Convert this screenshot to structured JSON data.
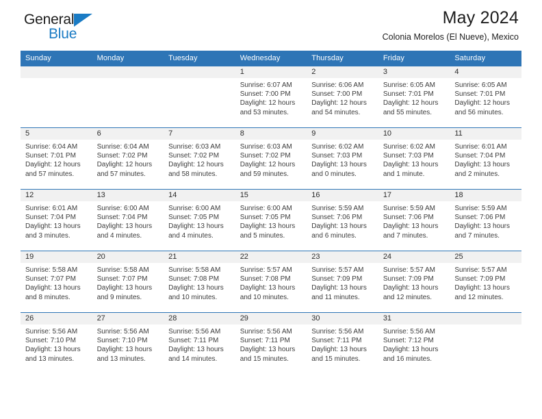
{
  "brand": {
    "line1": "General",
    "line2": "Blue",
    "accent_color": "#1a7bc4"
  },
  "header": {
    "title": "May 2024",
    "subtitle": "Colonia Morelos (El Nueve), Mexico"
  },
  "theme": {
    "header_bg": "#2e75b6",
    "daynum_band_bg": "#f1f1f1",
    "row_divider": "#2e75b6",
    "text": "#3b3b3b"
  },
  "weekday_headers": [
    "Sunday",
    "Monday",
    "Tuesday",
    "Wednesday",
    "Thursday",
    "Friday",
    "Saturday"
  ],
  "labels": {
    "sunrise_prefix": "Sunrise: ",
    "sunset_prefix": "Sunset: ",
    "daylight_prefix": "Daylight: "
  },
  "weeks": [
    [
      {
        "day": "",
        "empty": true
      },
      {
        "day": "",
        "empty": true
      },
      {
        "day": "",
        "empty": true
      },
      {
        "day": "1",
        "sunrise": "Sunrise: 6:07 AM",
        "sunset": "Sunset: 7:00 PM",
        "daylight_line1": "Daylight: 12 hours",
        "daylight_line2": "and 53 minutes."
      },
      {
        "day": "2",
        "sunrise": "Sunrise: 6:06 AM",
        "sunset": "Sunset: 7:00 PM",
        "daylight_line1": "Daylight: 12 hours",
        "daylight_line2": "and 54 minutes."
      },
      {
        "day": "3",
        "sunrise": "Sunrise: 6:05 AM",
        "sunset": "Sunset: 7:01 PM",
        "daylight_line1": "Daylight: 12 hours",
        "daylight_line2": "and 55 minutes."
      },
      {
        "day": "4",
        "sunrise": "Sunrise: 6:05 AM",
        "sunset": "Sunset: 7:01 PM",
        "daylight_line1": "Daylight: 12 hours",
        "daylight_line2": "and 56 minutes."
      }
    ],
    [
      {
        "day": "5",
        "sunrise": "Sunrise: 6:04 AM",
        "sunset": "Sunset: 7:01 PM",
        "daylight_line1": "Daylight: 12 hours",
        "daylight_line2": "and 57 minutes."
      },
      {
        "day": "6",
        "sunrise": "Sunrise: 6:04 AM",
        "sunset": "Sunset: 7:02 PM",
        "daylight_line1": "Daylight: 12 hours",
        "daylight_line2": "and 57 minutes."
      },
      {
        "day": "7",
        "sunrise": "Sunrise: 6:03 AM",
        "sunset": "Sunset: 7:02 PM",
        "daylight_line1": "Daylight: 12 hours",
        "daylight_line2": "and 58 minutes."
      },
      {
        "day": "8",
        "sunrise": "Sunrise: 6:03 AM",
        "sunset": "Sunset: 7:02 PM",
        "daylight_line1": "Daylight: 12 hours",
        "daylight_line2": "and 59 minutes."
      },
      {
        "day": "9",
        "sunrise": "Sunrise: 6:02 AM",
        "sunset": "Sunset: 7:03 PM",
        "daylight_line1": "Daylight: 13 hours",
        "daylight_line2": "and 0 minutes."
      },
      {
        "day": "10",
        "sunrise": "Sunrise: 6:02 AM",
        "sunset": "Sunset: 7:03 PM",
        "daylight_line1": "Daylight: 13 hours",
        "daylight_line2": "and 1 minute."
      },
      {
        "day": "11",
        "sunrise": "Sunrise: 6:01 AM",
        "sunset": "Sunset: 7:04 PM",
        "daylight_line1": "Daylight: 13 hours",
        "daylight_line2": "and 2 minutes."
      }
    ],
    [
      {
        "day": "12",
        "sunrise": "Sunrise: 6:01 AM",
        "sunset": "Sunset: 7:04 PM",
        "daylight_line1": "Daylight: 13 hours",
        "daylight_line2": "and 3 minutes."
      },
      {
        "day": "13",
        "sunrise": "Sunrise: 6:00 AM",
        "sunset": "Sunset: 7:04 PM",
        "daylight_line1": "Daylight: 13 hours",
        "daylight_line2": "and 4 minutes."
      },
      {
        "day": "14",
        "sunrise": "Sunrise: 6:00 AM",
        "sunset": "Sunset: 7:05 PM",
        "daylight_line1": "Daylight: 13 hours",
        "daylight_line2": "and 4 minutes."
      },
      {
        "day": "15",
        "sunrise": "Sunrise: 6:00 AM",
        "sunset": "Sunset: 7:05 PM",
        "daylight_line1": "Daylight: 13 hours",
        "daylight_line2": "and 5 minutes."
      },
      {
        "day": "16",
        "sunrise": "Sunrise: 5:59 AM",
        "sunset": "Sunset: 7:06 PM",
        "daylight_line1": "Daylight: 13 hours",
        "daylight_line2": "and 6 minutes."
      },
      {
        "day": "17",
        "sunrise": "Sunrise: 5:59 AM",
        "sunset": "Sunset: 7:06 PM",
        "daylight_line1": "Daylight: 13 hours",
        "daylight_line2": "and 7 minutes."
      },
      {
        "day": "18",
        "sunrise": "Sunrise: 5:59 AM",
        "sunset": "Sunset: 7:06 PM",
        "daylight_line1": "Daylight: 13 hours",
        "daylight_line2": "and 7 minutes."
      }
    ],
    [
      {
        "day": "19",
        "sunrise": "Sunrise: 5:58 AM",
        "sunset": "Sunset: 7:07 PM",
        "daylight_line1": "Daylight: 13 hours",
        "daylight_line2": "and 8 minutes."
      },
      {
        "day": "20",
        "sunrise": "Sunrise: 5:58 AM",
        "sunset": "Sunset: 7:07 PM",
        "daylight_line1": "Daylight: 13 hours",
        "daylight_line2": "and 9 minutes."
      },
      {
        "day": "21",
        "sunrise": "Sunrise: 5:58 AM",
        "sunset": "Sunset: 7:08 PM",
        "daylight_line1": "Daylight: 13 hours",
        "daylight_line2": "and 10 minutes."
      },
      {
        "day": "22",
        "sunrise": "Sunrise: 5:57 AM",
        "sunset": "Sunset: 7:08 PM",
        "daylight_line1": "Daylight: 13 hours",
        "daylight_line2": "and 10 minutes."
      },
      {
        "day": "23",
        "sunrise": "Sunrise: 5:57 AM",
        "sunset": "Sunset: 7:09 PM",
        "daylight_line1": "Daylight: 13 hours",
        "daylight_line2": "and 11 minutes."
      },
      {
        "day": "24",
        "sunrise": "Sunrise: 5:57 AM",
        "sunset": "Sunset: 7:09 PM",
        "daylight_line1": "Daylight: 13 hours",
        "daylight_line2": "and 12 minutes."
      },
      {
        "day": "25",
        "sunrise": "Sunrise: 5:57 AM",
        "sunset": "Sunset: 7:09 PM",
        "daylight_line1": "Daylight: 13 hours",
        "daylight_line2": "and 12 minutes."
      }
    ],
    [
      {
        "day": "26",
        "sunrise": "Sunrise: 5:56 AM",
        "sunset": "Sunset: 7:10 PM",
        "daylight_line1": "Daylight: 13 hours",
        "daylight_line2": "and 13 minutes."
      },
      {
        "day": "27",
        "sunrise": "Sunrise: 5:56 AM",
        "sunset": "Sunset: 7:10 PM",
        "daylight_line1": "Daylight: 13 hours",
        "daylight_line2": "and 13 minutes."
      },
      {
        "day": "28",
        "sunrise": "Sunrise: 5:56 AM",
        "sunset": "Sunset: 7:11 PM",
        "daylight_line1": "Daylight: 13 hours",
        "daylight_line2": "and 14 minutes."
      },
      {
        "day": "29",
        "sunrise": "Sunrise: 5:56 AM",
        "sunset": "Sunset: 7:11 PM",
        "daylight_line1": "Daylight: 13 hours",
        "daylight_line2": "and 15 minutes."
      },
      {
        "day": "30",
        "sunrise": "Sunrise: 5:56 AM",
        "sunset": "Sunset: 7:11 PM",
        "daylight_line1": "Daylight: 13 hours",
        "daylight_line2": "and 15 minutes."
      },
      {
        "day": "31",
        "sunrise": "Sunrise: 5:56 AM",
        "sunset": "Sunset: 7:12 PM",
        "daylight_line1": "Daylight: 13 hours",
        "daylight_line2": "and 16 minutes."
      },
      {
        "day": "",
        "empty": true
      }
    ]
  ]
}
